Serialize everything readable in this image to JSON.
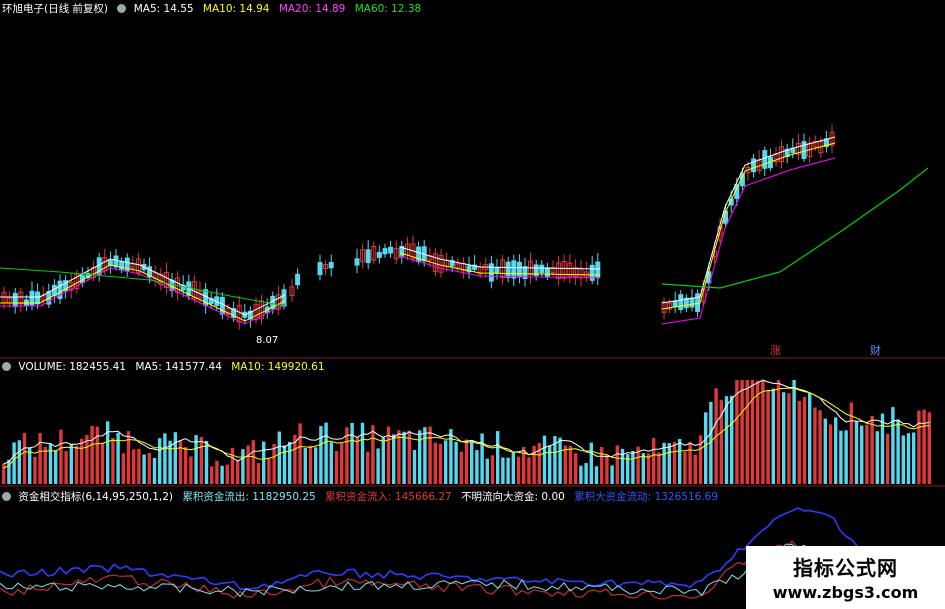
{
  "price_header": {
    "name": "环旭电子(日线 前复权)",
    "ma5": "MA5: 14.55",
    "ma10": "MA10: 14.94",
    "ma20": "MA20: 14.89",
    "ma60": "MA60: 12.38"
  },
  "volume_header": {
    "volume": "VOLUME: 182455.41",
    "ma5": "MA5: 141577.44",
    "ma10": "MA10: 149920.61"
  },
  "indicator_header": {
    "name": "资金相交指标(6,14,95,250,1,2)",
    "outflow": "累积资金流出: 1182950.25",
    "inflow": "累积资金流入: 145666.27",
    "unclear": "不明流向大资金: 0.00",
    "big": "累积大资金流动: 1326516.69"
  },
  "annotations": {
    "low_price": "8.07",
    "tag_rise": "涨",
    "tag_fin": "财"
  },
  "watermark": {
    "title": "指标公式网",
    "url": "www.zbgs3.com"
  },
  "colors": {
    "up": "#e0383a",
    "down": "#54d9f0",
    "ma5": "#ffffff",
    "ma10": "#ffff00",
    "ma20": "#ff00ff",
    "ma60": "#00d000",
    "sep": "#8b1a1a"
  },
  "chart_data": [
    {
      "type": "candlestick",
      "series": [
        {
          "name": "MA5",
          "value": 14.55
        },
        {
          "name": "MA10",
          "value": 14.94
        },
        {
          "name": "MA20",
          "value": 14.89
        },
        {
          "name": "MA60",
          "value": 12.38
        }
      ],
      "annotations": [
        "8.07"
      ]
    },
    {
      "type": "bar",
      "series": [
        {
          "name": "VOLUME",
          "value": 182455.41
        },
        {
          "name": "MA5",
          "value": 141577.44
        },
        {
          "name": "MA10",
          "value": 149920.61
        }
      ]
    },
    {
      "type": "line",
      "series": [
        {
          "name": "累积资金流出",
          "value": 1182950.25
        },
        {
          "name": "累积资金流入",
          "value": 145666.27
        },
        {
          "name": "不明流向大资金",
          "value": 0.0
        },
        {
          "name": "累积大资金流动",
          "value": 1326516.69
        }
      ]
    }
  ]
}
